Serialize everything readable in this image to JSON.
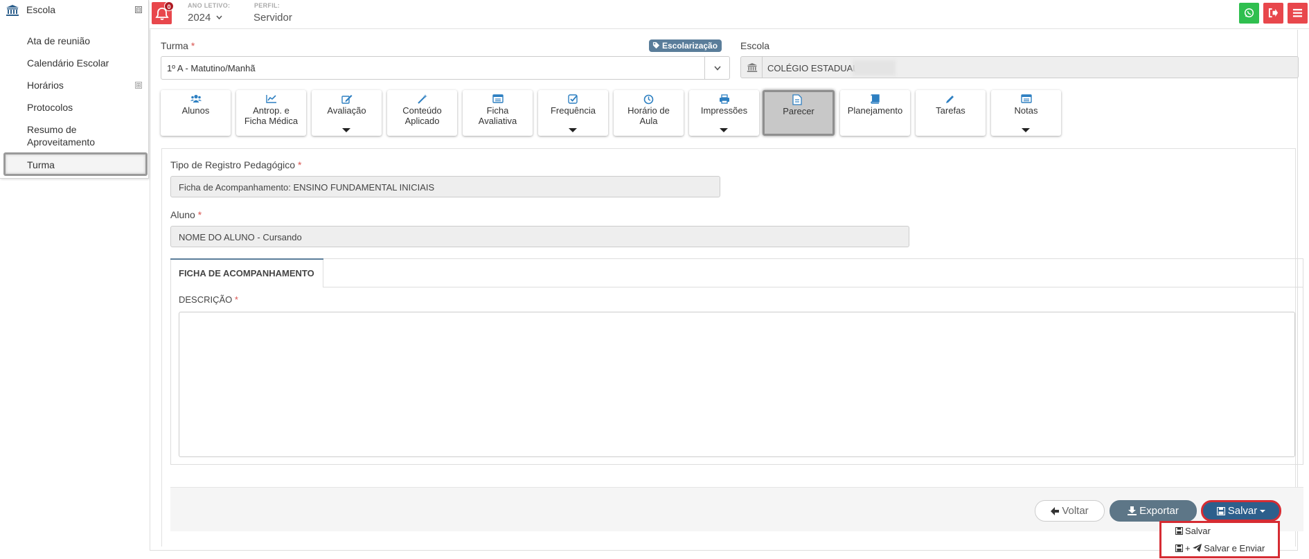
{
  "sidebar": {
    "title": "Escola",
    "collapse_symbol": "⊟",
    "expand_symbol": "⊞",
    "items": [
      "Ata de reunião",
      "Calendário Escolar",
      "Horários",
      "Protocolos",
      "Resumo de",
      "Aproveitamento"
    ],
    "active_item": "Turma"
  },
  "topbar": {
    "notifications": "0",
    "year_label": "ANO LETIVO:",
    "year_value": "2024",
    "profile_label": "PERFIL:",
    "profile_value": "Servidor"
  },
  "form": {
    "turma_label": "Turma",
    "required_mark": "*",
    "turma_value": "1º A - Matutino/Manhã",
    "tag_label": "Escolarização",
    "escola_label": "Escola",
    "escola_value": "COLÉGIO ESTADUAL",
    "tipo_label": "Tipo de Registro Pedagógico",
    "tipo_value": "Ficha de Acompanhamento: ENSINO FUNDAMENTAL INICIAIS",
    "aluno_label": "Aluno",
    "aluno_value": "NOME DO ALUNO - Cursando",
    "tab_label": "FICHA DE ACOMPANHAMENTO",
    "descricao_label": "DESCRIÇÃO"
  },
  "tiles": [
    {
      "l1": "Alunos",
      "l2": ""
    },
    {
      "l1": "Antrop. e",
      "l2": "Ficha Médica"
    },
    {
      "l1": "Avaliação",
      "l2": ""
    },
    {
      "l1": "Conteúdo",
      "l2": "Aplicado"
    },
    {
      "l1": "Ficha",
      "l2": "Avaliativa"
    },
    {
      "l1": "Frequência",
      "l2": ""
    },
    {
      "l1": "Horário de",
      "l2": "Aula"
    },
    {
      "l1": "Impressões",
      "l2": ""
    },
    {
      "l1": "Parecer",
      "l2": ""
    },
    {
      "l1": "Planejamento",
      "l2": ""
    },
    {
      "l1": "Tarefas",
      "l2": ""
    },
    {
      "l1": "Notas",
      "l2": ""
    }
  ],
  "buttons": {
    "voltar": "Voltar",
    "exportar": "Exportar",
    "salvar": "Salvar"
  },
  "dropdown": {
    "item1": "Salvar",
    "item2_plus": "+",
    "item2": "Salvar e Enviar"
  },
  "colors": {
    "danger": "#e8474c",
    "whatsapp": "#2fbf4f",
    "primary": "#2d5f8c",
    "tag": "#5a7d9a"
  }
}
